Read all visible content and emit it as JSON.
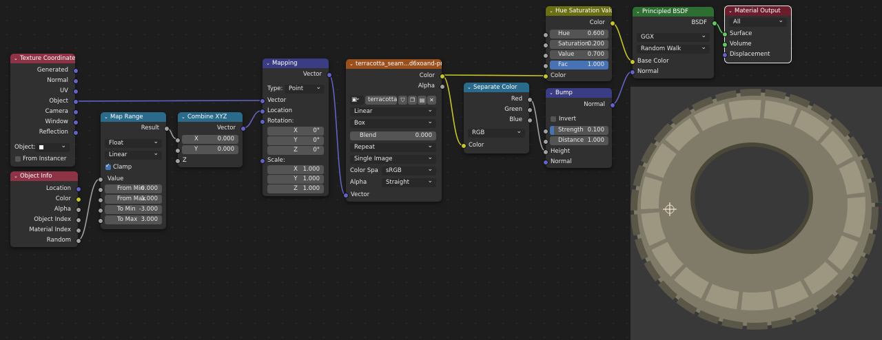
{
  "colors": {
    "background": "#1d1d1d",
    "node_body": "#303030",
    "input_header": "#8e3245",
    "texture_header": "#9b4f1c",
    "vector_header": "#3b3d84",
    "converter_header": "#2a6b8c",
    "color_header": "#6b6e12",
    "shader_header": "#2f6e33",
    "output_header": "#6b1d2c",
    "vector_socket": "#6363c7",
    "float_socket": "#a1a1a1",
    "color_socket": "#c7c729",
    "shader_socket": "#63c763",
    "field_blue": "#4772b3"
  },
  "texture_coordinate": {
    "title": "Texture Coordinate",
    "outputs": [
      "Generated",
      "Normal",
      "UV",
      "Object",
      "Camera",
      "Window",
      "Reflection"
    ],
    "object_label": "Object:",
    "from_instancer": "From Instancer"
  },
  "object_info": {
    "title": "Object Info",
    "outputs": [
      "Location",
      "Color",
      "Alpha",
      "Object Index",
      "Material Index",
      "Random"
    ]
  },
  "map_range": {
    "title": "Map Range",
    "output": "Result",
    "data_type": "Float",
    "interpolation": "Linear",
    "clamp": "Clamp",
    "input": "Value",
    "fields": [
      {
        "label": "From Min",
        "value": "0.000"
      },
      {
        "label": "From Max",
        "value": "1.000"
      },
      {
        "label": "To Min",
        "value": "-3.000"
      },
      {
        "label": "To Max",
        "value": "3.000"
      }
    ]
  },
  "combine_xyz": {
    "title": "Combine XYZ",
    "output": "Vector",
    "x": {
      "label": "X",
      "value": "0.000"
    },
    "y": {
      "label": "Y",
      "value": "0.000"
    },
    "z": "Z"
  },
  "mapping": {
    "title": "Mapping",
    "output": "Vector",
    "type_label": "Type:",
    "type_value": "Point",
    "vector": "Vector",
    "location": "Location",
    "rotation": "Rotation:",
    "rot": [
      {
        "label": "X",
        "value": "0°"
      },
      {
        "label": "Y",
        "value": "0°"
      },
      {
        "label": "Z",
        "value": "0°"
      }
    ],
    "scale": "Scale:",
    "scl": [
      {
        "label": "X",
        "value": "1.000"
      },
      {
        "label": "Y",
        "value": "1.000"
      },
      {
        "label": "Z",
        "value": "1.000"
      }
    ]
  },
  "image_texture": {
    "title": "terracotta_seam...d6xoand-pre.jp",
    "out_color": "Color",
    "out_alpha": "Alpha",
    "image_name": "terracotta...",
    "interpolation": "Linear",
    "projection": "Box",
    "blend_label": "Blend",
    "blend_value": "0.000",
    "extension": "Repeat",
    "source": "Single Image",
    "color_space_label": "Color Spa",
    "color_space": "sRGB",
    "alpha_label": "Alpha",
    "alpha_mode": "Straight",
    "input": "Vector"
  },
  "separate_color": {
    "title": "Separate Color",
    "outputs": [
      "Red",
      "Green",
      "Blue"
    ],
    "mode": "RGB",
    "input": "Color"
  },
  "hue_saturation": {
    "title": "Hue Saturation Value",
    "output": "Color",
    "fields": [
      {
        "label": "Hue",
        "value": "0.600"
      },
      {
        "label": "Saturation",
        "value": "0.200"
      },
      {
        "label": "Value",
        "value": "0.700"
      },
      {
        "label": "Fac",
        "value": "1.000"
      }
    ],
    "input": "Color"
  },
  "bump": {
    "title": "Bump",
    "output": "Normal",
    "invert": "Invert",
    "strength": {
      "label": "Strength",
      "value": "0.100"
    },
    "distance": {
      "label": "Distance",
      "value": "1.000"
    },
    "height": "Height",
    "normal": "Normal"
  },
  "principled": {
    "title": "Principled BSDF",
    "output": "BSDF",
    "distribution": "GGX",
    "subsurface": "Random Walk",
    "base_color": "Base Color",
    "normal": "Normal"
  },
  "material_output": {
    "title": "Material Output",
    "target": "All",
    "inputs": [
      "Surface",
      "Volume",
      "Displacement"
    ]
  }
}
